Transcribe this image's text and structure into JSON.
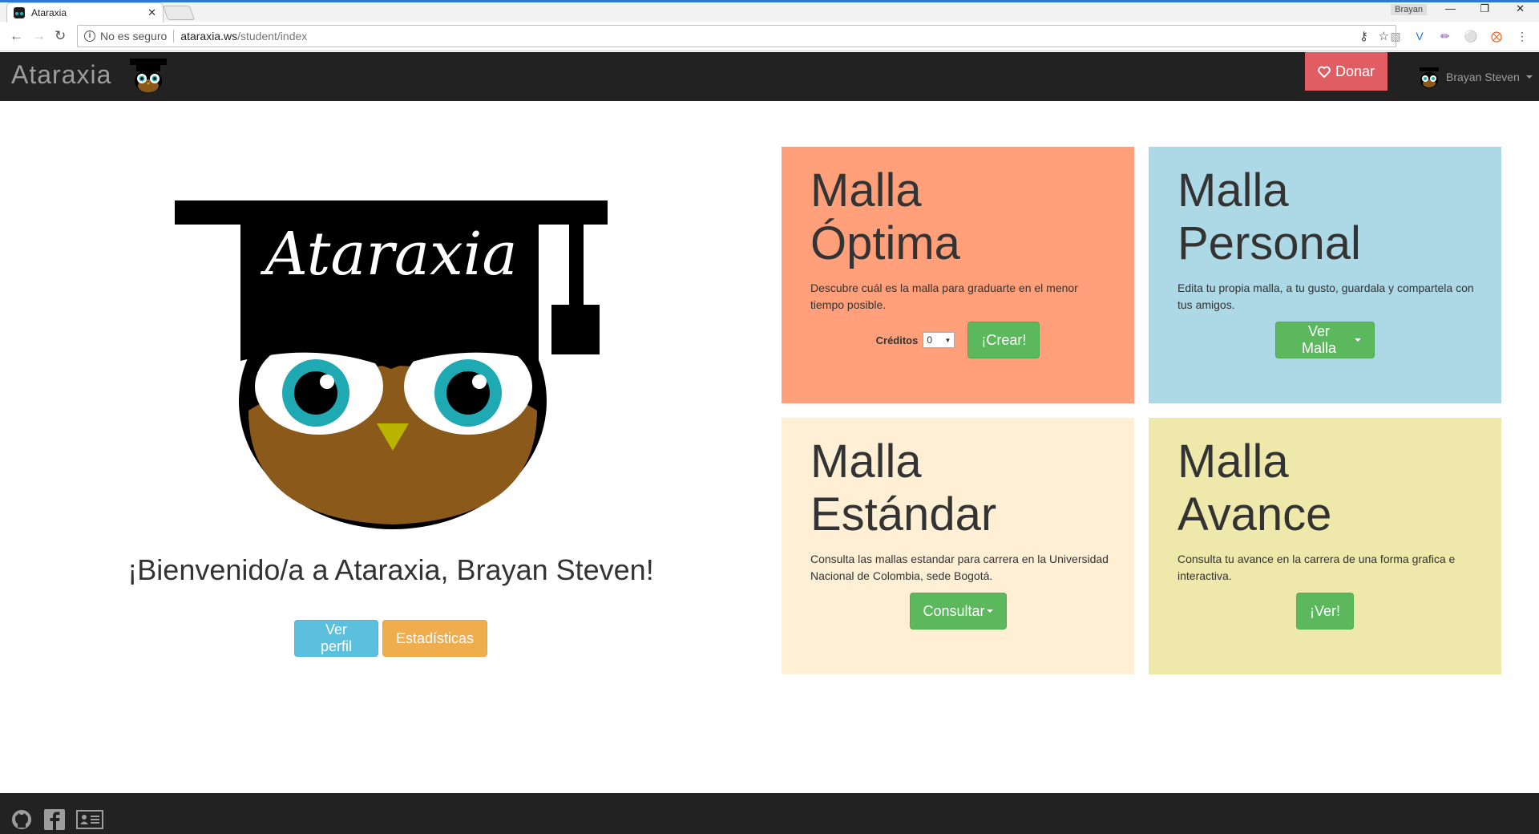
{
  "browser": {
    "tab_title": "Ataraxia",
    "tab_close": "✕",
    "window_user": "Brayan",
    "security_text": "No es seguro",
    "url_host": "ataraxia.ws",
    "url_path": "/student/index"
  },
  "navbar": {
    "brand": "Ataraxia",
    "donate_label": "Donar",
    "user_name": "Brayan Steven"
  },
  "hero": {
    "logo_text": "Ataraxia",
    "welcome": "¡Bienvenido/a a Ataraxia, Brayan Steven!",
    "profile_button": "Ver perfil",
    "stats_button": "Estadísticas"
  },
  "cards": [
    {
      "title_line1": "Malla",
      "title_line2": "Óptima",
      "description": "Descubre cuál es la malla para graduarte en el menor tiempo posible.",
      "credits_label": "Créditos",
      "credits_value": "0",
      "button": "¡Crear!",
      "color": "#ffa07a"
    },
    {
      "title_line1": "Malla",
      "title_line2": "Personal",
      "description": "Edita tu propia malla, a tu gusto, guardala y compartela con tus amigos.",
      "button": "Ver Malla",
      "color": "#add8e6"
    },
    {
      "title_line1": "Malla",
      "title_line2": "Estándar",
      "description": "Consulta las mallas estandar para carrera en la Universidad Nacional de Colombia, sede Bogotá.",
      "button": "Consultar",
      "color": "#ffefd5"
    },
    {
      "title_line1": "Malla",
      "title_line2": "Avance",
      "description": "Consulta tu avance en la carrera de una forma grafica e interactiva.",
      "button": "¡Ver!",
      "color": "#eee8aa"
    }
  ],
  "footer": {
    "icons": [
      "github-icon",
      "facebook-icon",
      "contact-card-icon"
    ]
  }
}
